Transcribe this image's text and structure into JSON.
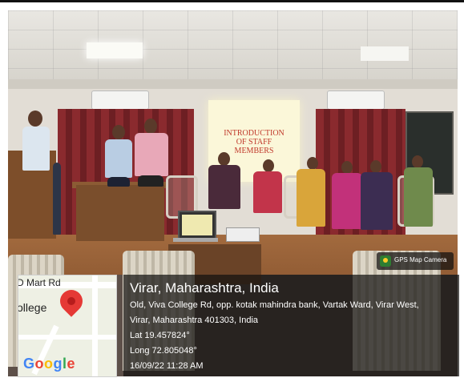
{
  "slide": {
    "lines": [
      "INTRODUCTION",
      "OF STAFF",
      "MEMBERS"
    ]
  },
  "map": {
    "road_label": "D Mart Rd",
    "place_label": "ollege",
    "brand": [
      "G",
      "o",
      "o",
      "g",
      "l",
      "e"
    ],
    "brand_colors": [
      "#4285F4",
      "#EA4335",
      "#FBBC05",
      "#4285F4",
      "#34A853",
      "#EA4335"
    ]
  },
  "badge": {
    "label": "GPS Map Camera"
  },
  "location": {
    "title": "Virar, Maharashtra, India",
    "address_line1": "Old, Viva College Rd, opp. kotak mahindra bank, Vartak Ward, Virar West,",
    "address_line2": "Virar, Maharashtra 401303, India",
    "lat": "Lat 19.457824°",
    "long": "Long 72.805048°",
    "datetime": "16/09/22 11:28 AM"
  }
}
